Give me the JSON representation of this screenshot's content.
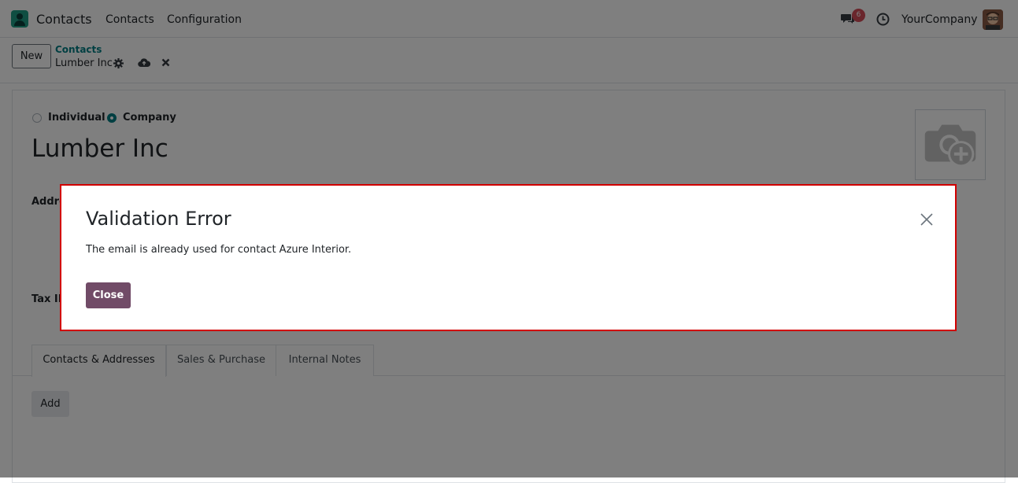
{
  "navbar": {
    "app_name": "Contacts",
    "menu": [
      "Contacts",
      "Configuration"
    ],
    "messages_count": "6",
    "company": "YourCompany"
  },
  "control_panel": {
    "new_label": "New",
    "breadcrumb_parent": "Contacts",
    "record_title": "Lumber Inc"
  },
  "form": {
    "type_options": [
      {
        "label": "Individual",
        "selected": false
      },
      {
        "label": "Company",
        "selected": true
      }
    ],
    "name": "Lumber Inc",
    "address_label": "Addre",
    "tax_id_label": "Tax ID",
    "tabs": [
      "Contacts & Addresses",
      "Sales & Purchase",
      "Internal Notes"
    ],
    "active_tab": 0,
    "add_label": "Add"
  },
  "dialog": {
    "title": "Validation Error",
    "message": "The email is already used for contact Azure Interior.",
    "close_label": "Close"
  },
  "colors": {
    "brand_purple": "#714b67",
    "teal": "#017e84",
    "highlight_border": "#d10000",
    "badge": "#d44c59"
  },
  "icons": [
    "chat-icon",
    "clock-icon",
    "gear-icon",
    "cloud-upload-icon",
    "close-icon",
    "camera-plus-icon"
  ]
}
